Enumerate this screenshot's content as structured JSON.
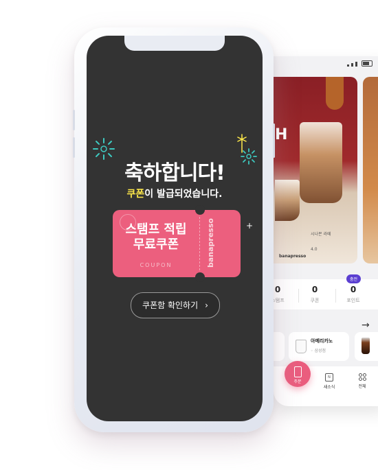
{
  "back_screen": {
    "promo": {
      "partial_letter": "H",
      "product_name": "시나몬 라떼",
      "price": "4.0",
      "brand": "banapresso"
    },
    "stats": [
      {
        "value": "0",
        "label": "쿠폰"
      },
      {
        "value": "0",
        "label": "포인트"
      }
    ],
    "stats_partial": {
      "value": "0",
      "label": "스탬프"
    },
    "charge_badge": "충전",
    "arrow": "→",
    "recent_card": {
      "title": "아메리카노",
      "store": "삼성점"
    },
    "tabs": {
      "order": "주문",
      "new_menu": "새소식",
      "all": "전체"
    },
    "new_menu_badge": "N"
  },
  "front_screen": {
    "headline": "축하합니다!",
    "subline_highlight": "쿠폰",
    "subline_rest": "이 발급되었습니다.",
    "coupon": {
      "title_line1": "스탬프 적립",
      "title_line2": "무료쿠폰",
      "label": "COUPON",
      "brand": "banapresso"
    },
    "confirm_button": "쿠폰함 확인하기",
    "confirm_chevron": "›",
    "plus_mark": "+"
  },
  "colors": {
    "screen_bg": "#333333",
    "coupon_pink": "#ec5f7e",
    "highlight_yellow": "#ffe94a",
    "firework_teal": "#3ec9c0",
    "order_button_pink": "#ea5d7e",
    "badge_purple": "#5b3fd1"
  }
}
